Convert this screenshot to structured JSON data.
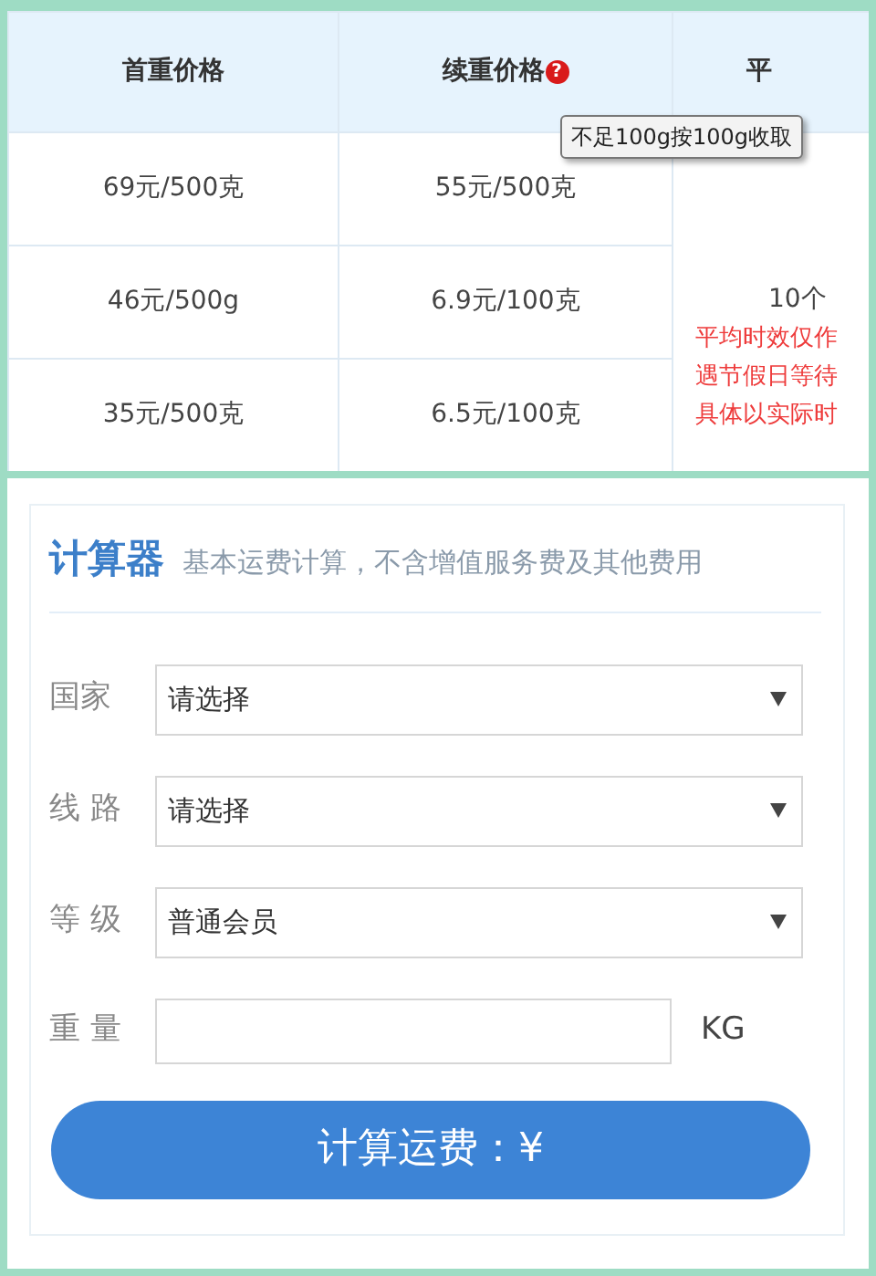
{
  "price_table": {
    "columns": [
      {
        "label": "首重价格"
      },
      {
        "label": "续重价格",
        "help": "?"
      },
      {
        "label": "平"
      }
    ],
    "rows": [
      {
        "first_weight": "69元/500克",
        "extra_weight": "55元/500克"
      },
      {
        "first_weight": "46元/500g",
        "extra_weight": "6.9元/100克"
      },
      {
        "first_weight": "35元/500克",
        "extra_weight": "6.5元/100克"
      }
    ],
    "merged_cell": {
      "value": "10个",
      "notes": [
        "平均时效仅作",
        "遇节假日等待",
        "具体以实际时"
      ]
    },
    "tooltip": "不足100g按100g收取"
  },
  "calculator": {
    "title": "计算器",
    "subtitle": "基本运费计算，不含增值服务费及其他费用",
    "fields": [
      {
        "kind": "select",
        "label": "国家",
        "value": "请选择"
      },
      {
        "kind": "select",
        "label": "线 路",
        "value": "请选择"
      },
      {
        "kind": "select",
        "label": "等 级",
        "value": "普通会员"
      },
      {
        "kind": "input",
        "label": "重 量",
        "unit": "KG"
      }
    ],
    "button": "计算运费：¥"
  }
}
